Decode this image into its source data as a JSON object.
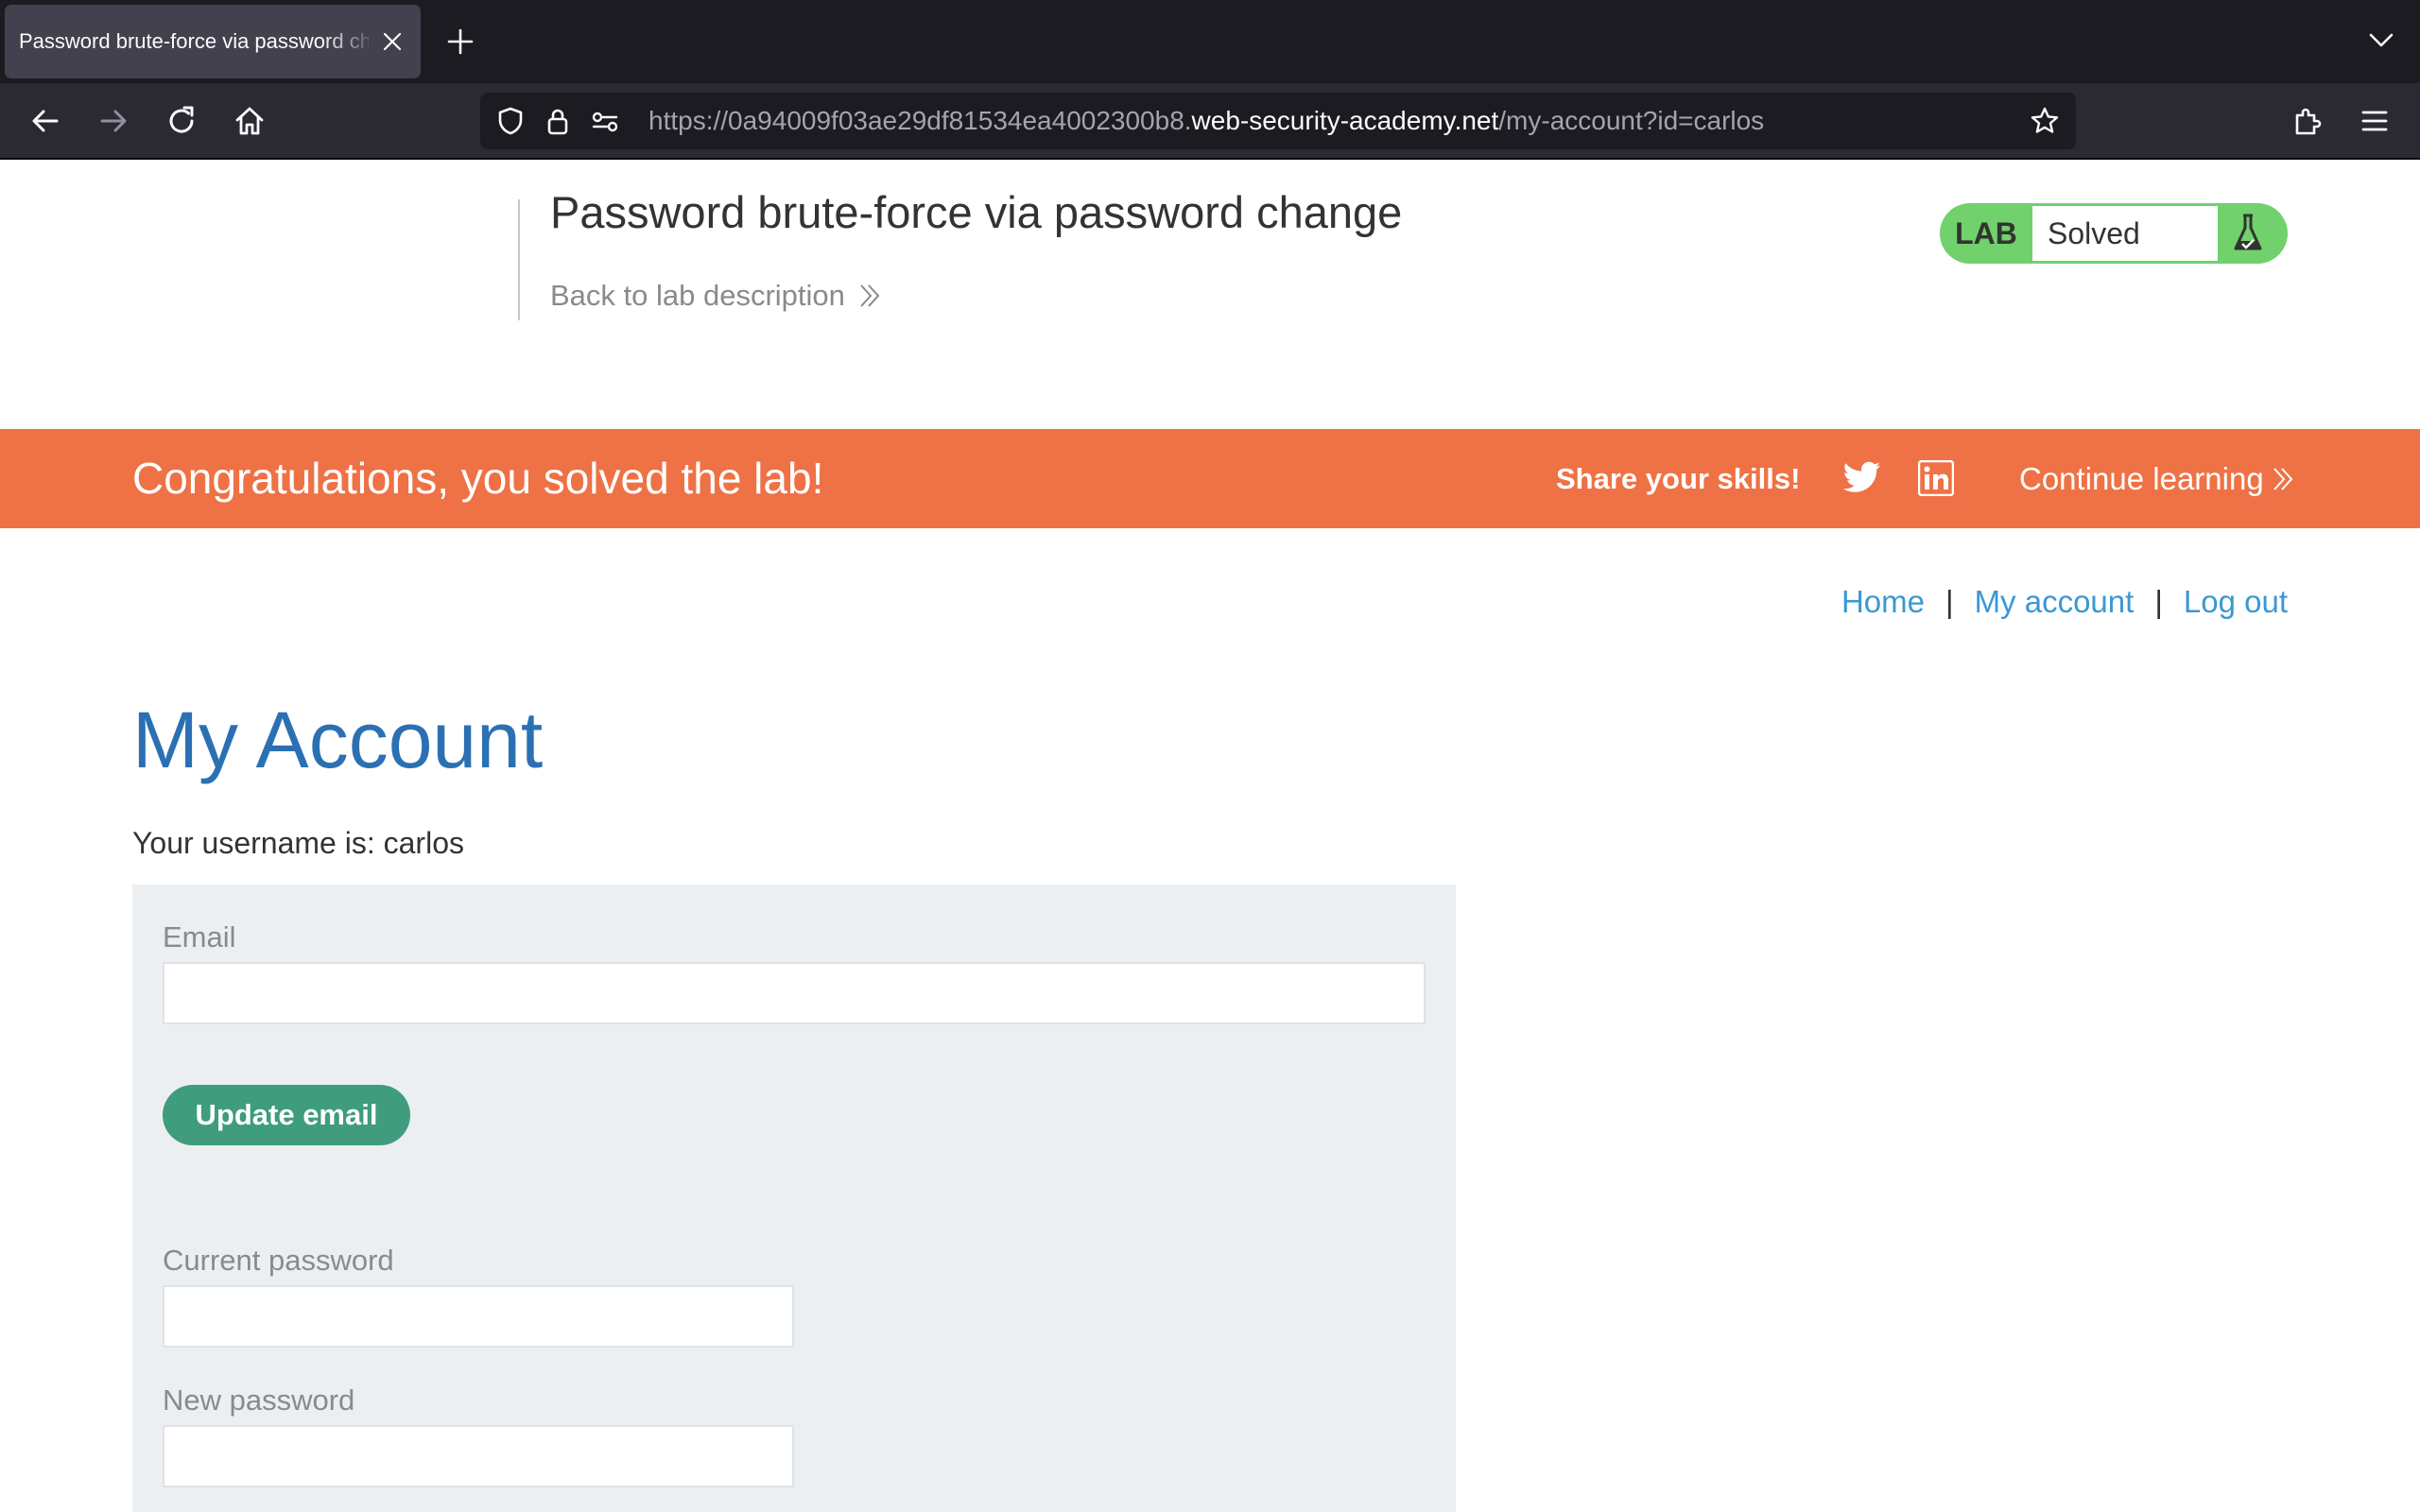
{
  "browser": {
    "tab_title": "Password brute-force via password change",
    "url_prefix": "https://0a94009f03ae29df81534ea4002300b8.",
    "url_host": "web-security-academy.net",
    "url_path": "/my-account?id=carlos"
  },
  "lab": {
    "title": "Password brute-force via password change",
    "back_link": "Back to lab description",
    "badge_label": "LAB",
    "status": "Solved"
  },
  "banner": {
    "message": "Congratulations, you solved the lab!",
    "share": "Share your skills!",
    "continue": "Continue learning"
  },
  "nav": {
    "home": "Home",
    "separator": "|",
    "my_account": "My account",
    "logout": "Log out"
  },
  "account": {
    "title": "My Account",
    "username_line": "Your username is: carlos",
    "email_label": "Email",
    "email_value": "",
    "update_email_button": "Update email",
    "current_password_label": "Current password",
    "new_password_label": "New password"
  },
  "colors": {
    "banner": "#ee7245",
    "badge_solved": "#70d16d",
    "link": "#3b98d4",
    "title": "#2b70b3",
    "button": "#3f9c7c"
  }
}
